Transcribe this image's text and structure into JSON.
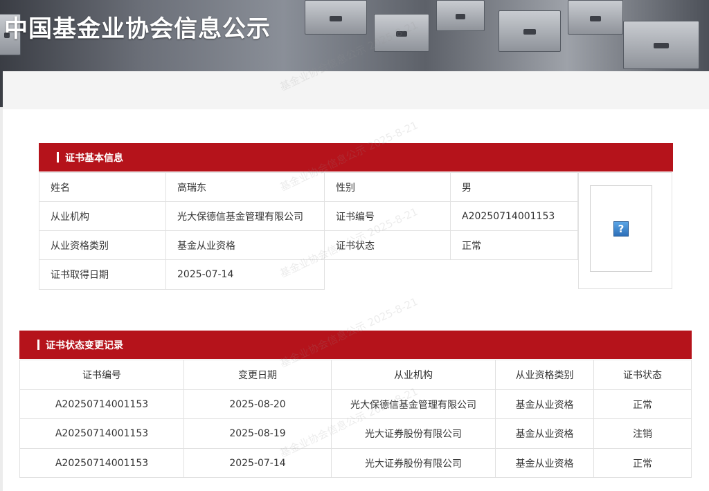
{
  "banner": {
    "title": "中国基金业协会信息公示"
  },
  "watermark_text": "基金业协会信息公示 2025-8-21",
  "basic_info": {
    "section_title": "证书基本信息",
    "rows": [
      {
        "label1": "姓名",
        "value1": "高瑞东",
        "label2": "性别",
        "value2": "男"
      },
      {
        "label1": "从业机构",
        "value1": "光大保德信基金管理有限公司",
        "label2": "证书编号",
        "value2": "A20250714001153"
      },
      {
        "label1": "从业资格类别",
        "value1": "基金从业资格",
        "label2": "证书状态",
        "value2": "正常"
      },
      {
        "label1": "证书取得日期",
        "value1": "2025-07-14"
      }
    ],
    "photo_placeholder": "?"
  },
  "change_records": {
    "section_title": "证书状态变更记录",
    "columns": [
      "证书编号",
      "变更日期",
      "从业机构",
      "从业资格类别",
      "证书状态"
    ],
    "rows": [
      [
        "A20250714001153",
        "2025-08-20",
        "光大保德信基金管理有限公司",
        "基金从业资格",
        "正常"
      ],
      [
        "A20250714001153",
        "2025-08-19",
        "光大证券股份有限公司",
        "基金从业资格",
        "注销"
      ],
      [
        "A20250714001153",
        "2025-07-14",
        "光大证券股份有限公司",
        "基金从业资格",
        "正常"
      ]
    ]
  },
  "colors": {
    "accent": "#b5131b",
    "border": "#e1e1e1"
  }
}
